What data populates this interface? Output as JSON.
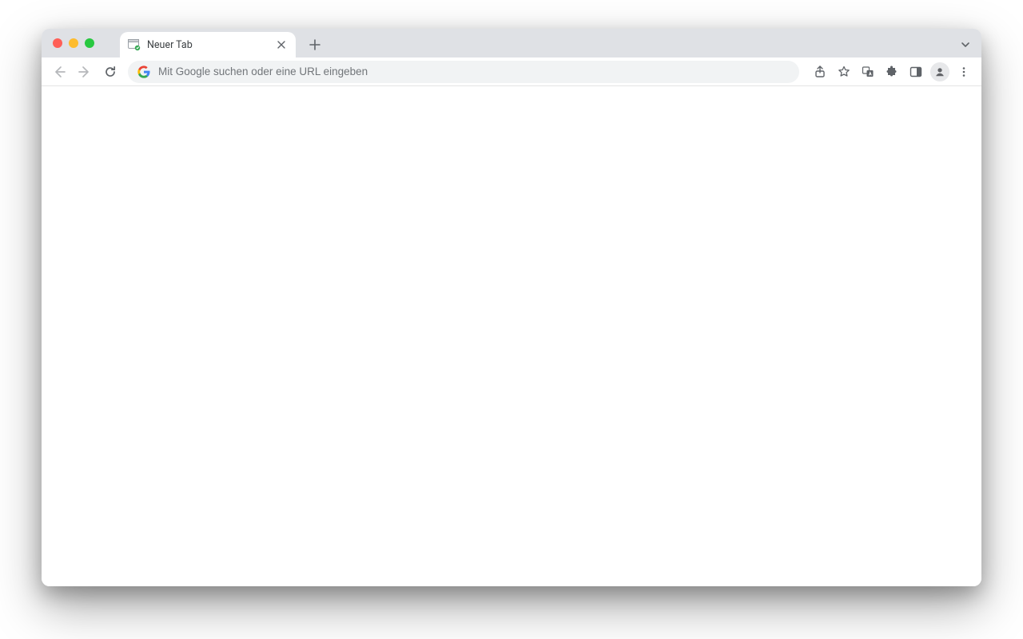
{
  "tabs": [
    {
      "title": "Neuer Tab"
    }
  ],
  "omnibox": {
    "placeholder": "Mit Google suchen oder eine URL eingeben",
    "value": ""
  },
  "colors": {
    "traffic_red": "#ff5f57",
    "traffic_yellow": "#febc2e",
    "traffic_green": "#28c840",
    "tabstrip_bg": "#dfe1e5",
    "toolbar_bg": "#ffffff",
    "omnibox_bg": "#f1f3f4",
    "icon": "#5f6368"
  }
}
